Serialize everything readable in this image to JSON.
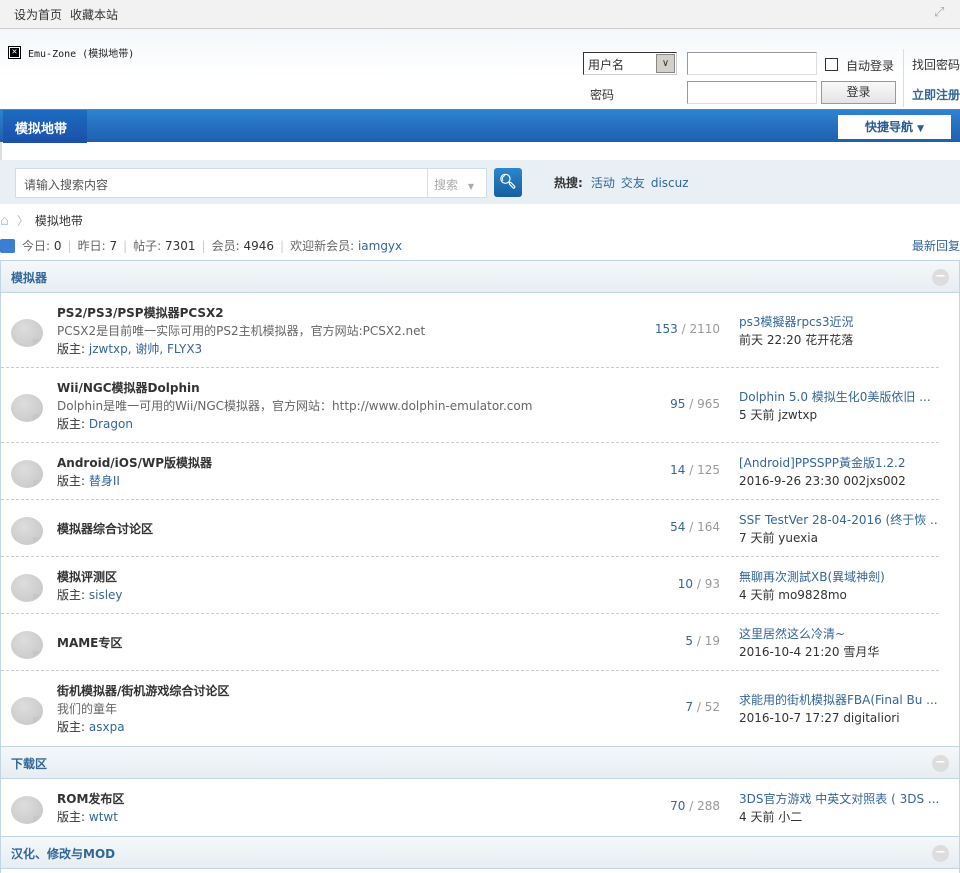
{
  "topbar": {
    "set_home": "设为首页",
    "bookmark": "收藏本站"
  },
  "logo": {
    "alt": "Emu-Zone (模拟地带)"
  },
  "login": {
    "user_type": "用户名",
    "password_label": "密码",
    "auto_login": "自动登录",
    "login_button": "登录",
    "forgot": "找回密码",
    "register": "立即注册"
  },
  "nav": {
    "current": "模拟地带",
    "quick_nav": "快捷导航"
  },
  "search": {
    "placeholder": "请输入搜索内容",
    "type": "搜索",
    "hot_label": "热搜:",
    "hot": [
      "活动",
      "交友",
      "discuz"
    ]
  },
  "breadcrumb": {
    "current": "模拟地带"
  },
  "stats": {
    "today_label": "今日:",
    "today": "0",
    "yesterday_label": "昨日:",
    "yesterday": "7",
    "posts_label": "帖子:",
    "posts": "7301",
    "members_label": "会员:",
    "members": "4946",
    "welcome_label": "欢迎新会员:",
    "newest": "iamgyx",
    "latest_replies": "最新回复"
  },
  "categories": [
    {
      "title": "模拟器",
      "forums": [
        {
          "name": "PS2/PS3/PSP模拟器PCSX2",
          "desc": "PCSX2是目前唯一实际可用的PS2主机模拟器，官方网站:PCSX2.net",
          "mods_label": "版主:",
          "mods": "jzwtxp, 谢帅, FLYX3",
          "threads": "153",
          "posts": "2110",
          "last_title": "ps3模擬器rpcs3近況",
          "last_meta": "前天 22:20 花开花落"
        },
        {
          "name": "Wii/NGC模拟器Dolphin",
          "desc": "Dolphin是唯一可用的Wii/NGC模拟器，官方网站：http://www.dolphin-emulator.com",
          "mods_label": "版主:",
          "mods": "Dragon",
          "threads": "95",
          "posts": "965",
          "last_title": "Dolphin 5.0 模拟生化0美版依旧 ...",
          "last_meta": "5 天前 jzwtxp"
        },
        {
          "name": "Android/iOS/WP版模拟器",
          "mods_label": "版主:",
          "mods": "替身II",
          "threads": "14",
          "posts": "125",
          "last_title": "[Android]PPSSPP黃金版1.2.2",
          "last_meta": "2016-9-26 23:30 002jxs002"
        },
        {
          "name": "模拟器综合讨论区",
          "threads": "54",
          "posts": "164",
          "last_title": "SSF TestVer 28-04-2016 (终于恢 ...",
          "last_meta": "7 天前 yuexia"
        },
        {
          "name": "模拟评测区",
          "mods_label": "版主:",
          "mods": "sisley",
          "threads": "10",
          "posts": "93",
          "last_title": "無聊再次測試XB(異域神劍)",
          "last_meta": "4 天前 mo9828mo"
        },
        {
          "name": "MAME专区",
          "threads": "5",
          "posts": "19",
          "last_title": "这里居然这么冷清~",
          "last_meta": "2016-10-4 21:20 雪月华"
        },
        {
          "name": "街机模拟器/街机游戏综合讨论区",
          "desc": "我们的童年",
          "mods_label": "版主:",
          "mods": "asxpa",
          "threads": "7",
          "posts": "52",
          "last_title": "求能用的街机模拟器FBA(Final Bu ...",
          "last_meta": "2016-10-7 17:27 digitaliori"
        }
      ]
    },
    {
      "title": "下载区",
      "forums": [
        {
          "name": "ROM发布区",
          "mods_label": "版主:",
          "mods": "wtwt",
          "threads": "70",
          "posts": "288",
          "last_title": "3DS官方游戏 中英文对照表 ( 3DS ...",
          "last_meta": "4 天前 小二"
        }
      ]
    },
    {
      "title": "汉化、修改与MOD",
      "forums": []
    }
  ]
}
